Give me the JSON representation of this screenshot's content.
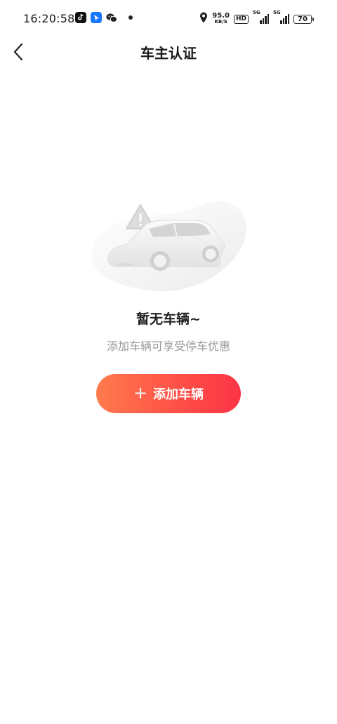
{
  "status_bar": {
    "time": "16:20:58",
    "net_speed_value": "95.0",
    "net_speed_unit": "KB/S",
    "hd_label": "HD",
    "sim1_label": "5G",
    "sim2_label": "5G",
    "battery_level": "70"
  },
  "nav": {
    "back_icon": "chevron-left-icon",
    "title": "车主认证"
  },
  "empty_state": {
    "illustration": "car-warning-illustration",
    "title": "暂无车辆~",
    "subtitle": "添加车辆可享受停车优惠"
  },
  "add_button": {
    "icon": "plus-icon",
    "label": "添加车辆",
    "gradient_start": "#ff7a4c",
    "gradient_end": "#fb3445"
  }
}
